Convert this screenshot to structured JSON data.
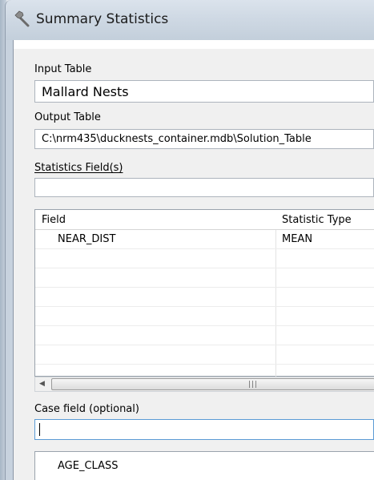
{
  "window": {
    "title": "Summary Statistics",
    "icon": "hammer-icon"
  },
  "input_table": {
    "label": "Input Table",
    "value": "Mallard Nests"
  },
  "output_table": {
    "label": "Output Table",
    "value": "C:\\nrm435\\ducknests_container.mdb\\Solution_Table"
  },
  "statistics_fields": {
    "label": "Statistics Field(s)",
    "value": "",
    "columns": [
      "Field",
      "Statistic Type"
    ],
    "rows": [
      {
        "field": "NEAR_DIST",
        "statistic": "MEAN"
      }
    ]
  },
  "case_field": {
    "label": "Case field (optional)",
    "value": ""
  },
  "case_list": {
    "items": [
      "AGE_CLASS"
    ]
  }
}
